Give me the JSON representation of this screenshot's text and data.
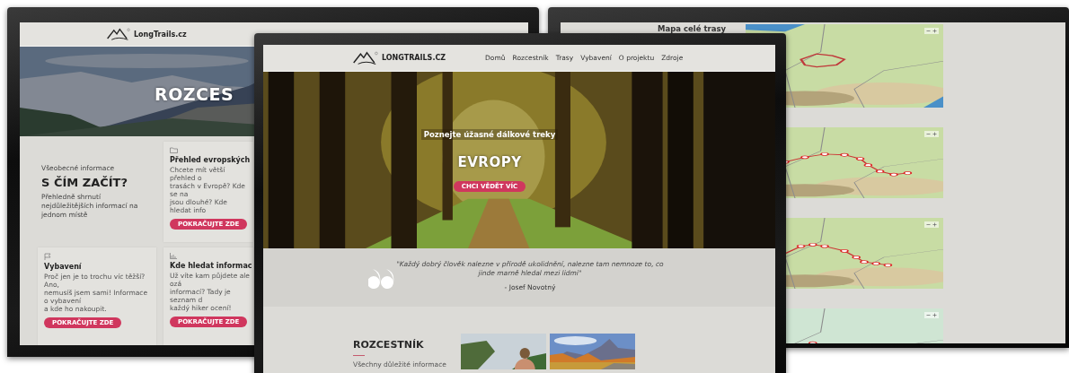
{
  "left_screen": {
    "logo_text": "LongTrails.cz",
    "hero_title": "ROZCES",
    "intro": {
      "eyebrow": "Všeobecné informace",
      "title": "S ČÍM ZAČÍT?",
      "text": "Přehledně shrnutí nejdůležitějších informací na jednom místě"
    },
    "cards": [
      {
        "kind": "folder",
        "title": "Přehled evropských",
        "lines": [
          "Chcete mít větší přehled o",
          "trasách v Evropě? Kde se na",
          "jsou dlouhé? Kde hledat info"
        ],
        "button": "POKRAČUJTE ZDE"
      },
      {
        "kind": "flag",
        "title": "Vybavení",
        "lines": [
          "Proč jen je to trochu víc těžší? Ano,",
          "nemusíš jsem sami! Informace o vybavení",
          "a kde ho nakoupit."
        ],
        "button": "POKRAČUJTE ZDE"
      },
      {
        "kind": "chart",
        "title": "Kde hledat informac",
        "lines": [
          "Už víte kam půjdete ale ozá",
          "informací? Tady je seznam d",
          "každý hiker ocení!"
        ],
        "button": "POKRAČUJTE ZDE"
      }
    ]
  },
  "middle_screen": {
    "logo_text": "LONGTRAILS.CZ",
    "nav": [
      "Domů",
      "Rozcestník",
      "Trasy",
      "Vybavení",
      "O projektu",
      "Zdroje"
    ],
    "hero": {
      "subtitle": "Poznejte úžasné dálkové treky",
      "title": "EVROPY",
      "button": "CHCI VĚDĚT VÍC"
    },
    "quote": {
      "text": "\"Každý dobrý člověk nalezne v přírodě ukolidnění, nalezne tam nemnoze to, co jinde marně hledal mezi lidmi\"",
      "author": "- Josef Novotný"
    },
    "section": {
      "title": "ROZCESTNÍK",
      "text": "Všechny důležité informace"
    }
  },
  "right_screen": {
    "title": "Mapa celé trasy"
  }
}
